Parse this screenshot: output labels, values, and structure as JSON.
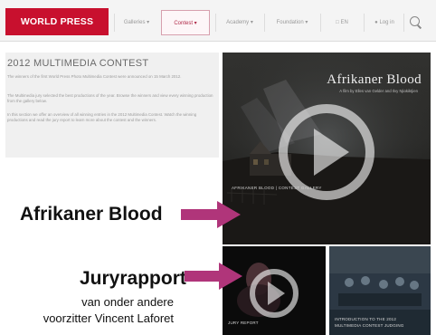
{
  "brand": {
    "logo_text": "WORLD PRESS PHOTO",
    "accent": "#c8102e",
    "annotation_arrow_color": "#b0357a"
  },
  "nav": {
    "items": [
      {
        "label": "Galleries",
        "active": false
      },
      {
        "label": "Contest",
        "active": true
      },
      {
        "label": "Academy",
        "active": false
      },
      {
        "label": "Foundation",
        "active": false
      },
      {
        "label": "EN",
        "active": false
      },
      {
        "label": "Log in",
        "active": false
      }
    ],
    "search_icon": "search-icon"
  },
  "article": {
    "title": "2012 MULTIMEDIA CONTEST",
    "paragraphs": [
      "The winners of the first World Press Photo Multimedia Contest were announced on 15 March 2012.",
      "The Multimedia jury selected the best productions of the year. Browse the winners and view every winning production from the gallery below.",
      "In this section we offer an overview of all winning entries in the 2012 Multimedia Contest. Watch the winning productions and read the jury report to learn more about the contest and the winners."
    ]
  },
  "featured_video": {
    "title": "Afrikaner Blood",
    "subtitle": "A film by Elles van Gelder and Ilvy Njiokiktjien",
    "caption": "AFRIKANER BLOOD | CONTEST GALLERY",
    "play_icon": "play-icon"
  },
  "thumbnails": [
    {
      "caption": "JURY REPORT",
      "play_icon": "play-icon"
    },
    {
      "caption_line1": "INTRODUCTION TO THE 2012",
      "caption_line2": "MULTIMEDIA CONTEST JUDGING"
    }
  ],
  "annotations": {
    "afrikaner": "Afrikaner Blood",
    "jury_title": "Juryrapport",
    "jury_line1": "van onder andere",
    "jury_line2": "voorzitter Vincent Laforet"
  }
}
